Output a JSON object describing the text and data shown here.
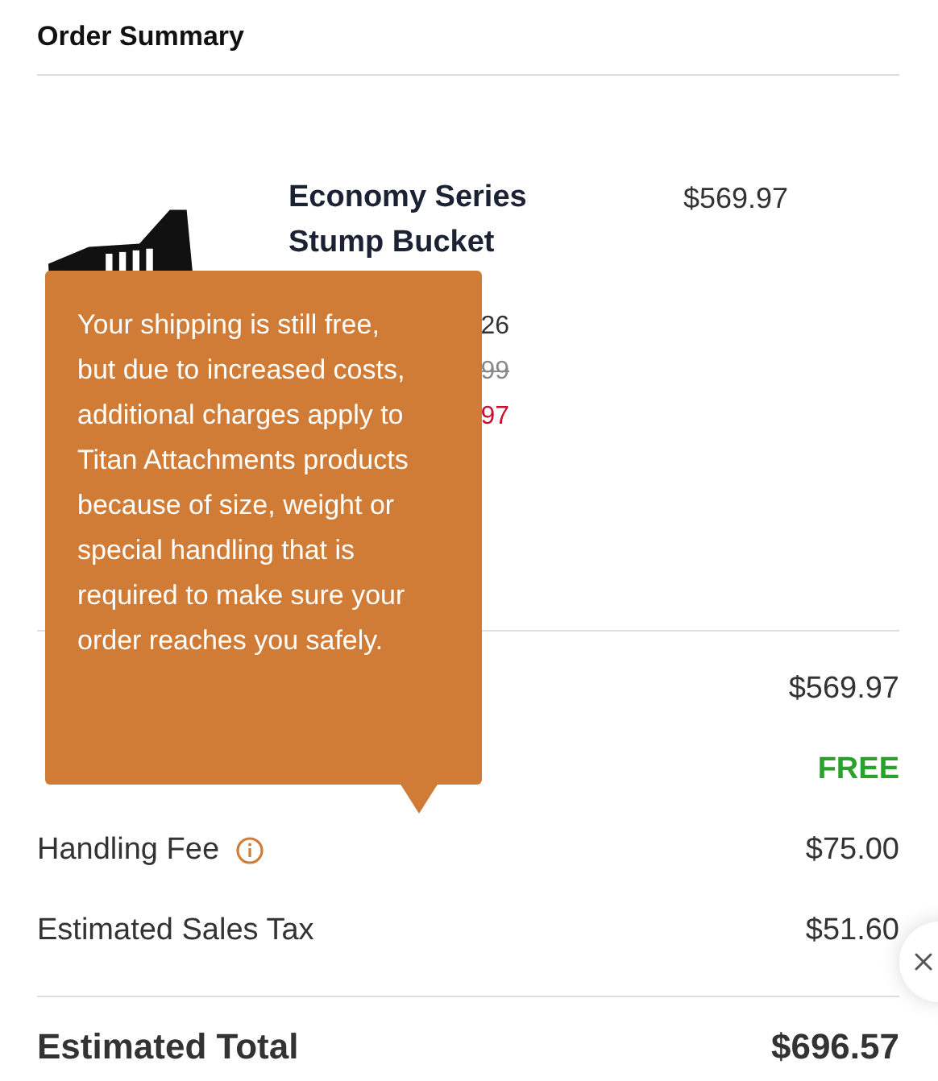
{
  "header": {
    "title": "Order Summary"
  },
  "item": {
    "name": "Economy Series Stump Bucket",
    "price": "$569.97",
    "detail_fragments": [
      {
        "text": "26",
        "kind": "plain"
      },
      {
        "text": "99",
        "kind": "struck"
      },
      {
        "text": "97",
        "kind": "sale"
      }
    ]
  },
  "summary": [
    {
      "value": "$569.97",
      "kind": "plain"
    },
    {
      "value": "FREE",
      "kind": "free"
    },
    {
      "label": "Handling Fee",
      "value": "$75.00",
      "kind": "info"
    },
    {
      "label": "Estimated Sales Tax",
      "value": "$51.60",
      "kind": "plain"
    }
  ],
  "total": {
    "label": "Estimated Total",
    "value": "$696.57"
  },
  "tooltip": {
    "text": "Your shipping is still free, but due to increased costs, additional charges apply to Titan Attachments products because of size, weight or special handling that is required to make sure your order reaches you safely."
  }
}
